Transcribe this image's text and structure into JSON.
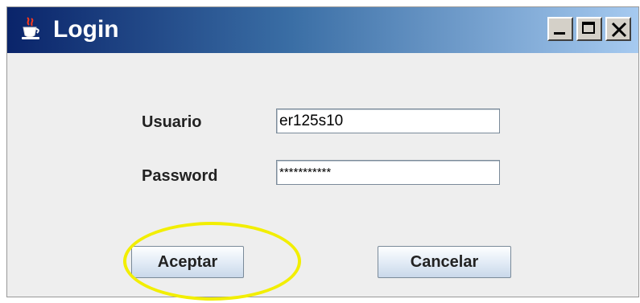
{
  "window": {
    "title": "Login",
    "controls": {
      "minimize": "minimize-icon",
      "maximize": "maximize-icon",
      "close": "close-icon"
    },
    "app_icon": "java-cup-icon"
  },
  "form": {
    "user_label": "Usuario",
    "user_value": "er125s10",
    "password_label": "Password",
    "password_value": "***********"
  },
  "buttons": {
    "accept_label": "Aceptar",
    "cancel_label": "Cancelar"
  },
  "colors": {
    "titlebar_start": "#0a246a",
    "titlebar_end": "#a6caf0",
    "highlight": "#f2ee00",
    "window_bg": "#eeeeee"
  }
}
